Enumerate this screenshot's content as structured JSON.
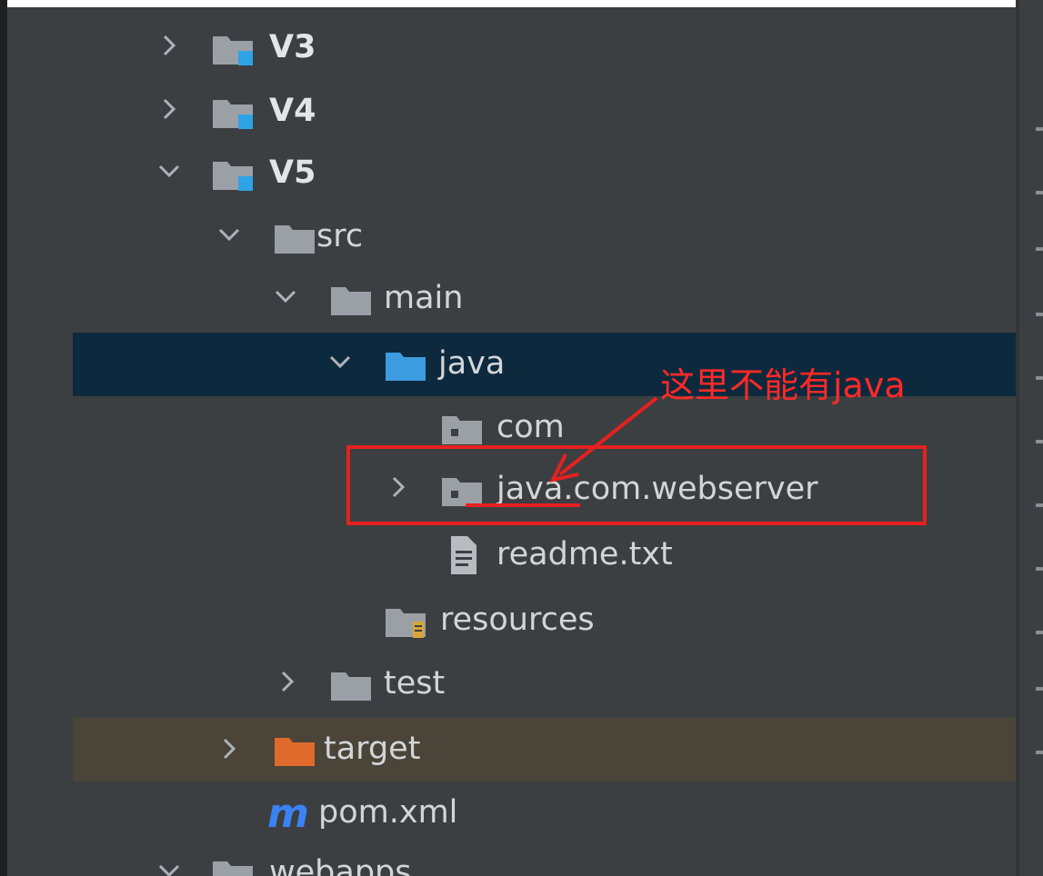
{
  "colors": {
    "panel_bg": "#3c3f41",
    "selected_row": "#0d293e",
    "excluded_row": "#4a4538",
    "folder_gray": "#9aa0a6",
    "folder_blue": "#3d9be0",
    "folder_orange": "#e06a2c",
    "module_badge": "#2ea3e6",
    "resources_badge": "#d9a63a",
    "maven_m": "#3b82f6",
    "annotation_red": "#e5211f",
    "text": "#d3d5d8"
  },
  "tree": {
    "items": [
      {
        "label": "V3",
        "icon": "module-folder-icon",
        "expanded": false
      },
      {
        "label": "V4",
        "icon": "module-folder-icon",
        "expanded": false
      },
      {
        "label": "V5",
        "icon": "module-folder-icon",
        "expanded": true
      },
      {
        "label": "src",
        "icon": "folder-icon",
        "expanded": true
      },
      {
        "label": "main",
        "icon": "folder-icon",
        "expanded": true
      },
      {
        "label": "java",
        "icon": "source-root-folder-icon",
        "expanded": true,
        "selected": true
      },
      {
        "label": "com",
        "icon": "package-icon"
      },
      {
        "label": "java.com.webserver",
        "icon": "package-icon",
        "expanded": false
      },
      {
        "label": "readme.txt",
        "icon": "text-file-icon"
      },
      {
        "label": "resources",
        "icon": "resources-folder-icon"
      },
      {
        "label": "test",
        "icon": "folder-icon",
        "expanded": false
      },
      {
        "label": "target",
        "icon": "excluded-folder-icon",
        "expanded": false
      },
      {
        "label": "pom.xml",
        "icon": "maven-icon"
      },
      {
        "label": "webapps",
        "icon": "folder-icon",
        "expanded": true
      }
    ]
  },
  "annotation": {
    "text": "这里不能有java"
  }
}
